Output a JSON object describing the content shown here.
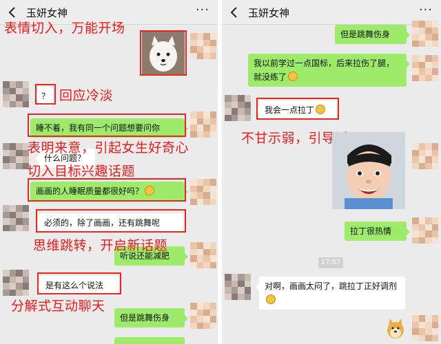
{
  "left": {
    "header": {
      "title": "玉妍女神",
      "more": "···"
    },
    "messages": {
      "q": "？",
      "m2": "睡不着，我有同一个问题想要问你",
      "m3": "什么问题？",
      "m4": "画画的人睡眠质量都很好吗？",
      "m5": "必须的，除了画画，还有跳舞呢",
      "m6": "听说还能减肥",
      "m7": "是有这么个说法",
      "m8": "但是跳舞伤身"
    },
    "notes": {
      "n1": "表情切入，万能开场",
      "n2": "回应冷淡",
      "n3": "表明来意，引起女生好奇心",
      "n4": "切入目标兴趣话题",
      "n5": "思维跳转，开启新话题",
      "n6": "分解式互动聊天"
    }
  },
  "right": {
    "header": {
      "title": "玉妍女神",
      "more": "···"
    },
    "messages": {
      "r1": "但是跳舞伤身",
      "r2": "我以前学过一点国标，后来拉伤了腿，就没练了",
      "r3": "我会一点拉丁",
      "r4": "拉丁很热情",
      "time": "17:57",
      "r5": "对啊，画画太闷了，跳拉丁正好调剂"
    },
    "notes": {
      "n1": "不甘示弱，引导话题"
    }
  },
  "colors": {
    "accent": "#e8261f",
    "bubble_green": "#9eea6a",
    "background": "#ebebeb"
  },
  "icons": {
    "back": "chevron-left-icon",
    "more": "more-dots-icon",
    "emoji": "smiley-emoji-icon"
  }
}
